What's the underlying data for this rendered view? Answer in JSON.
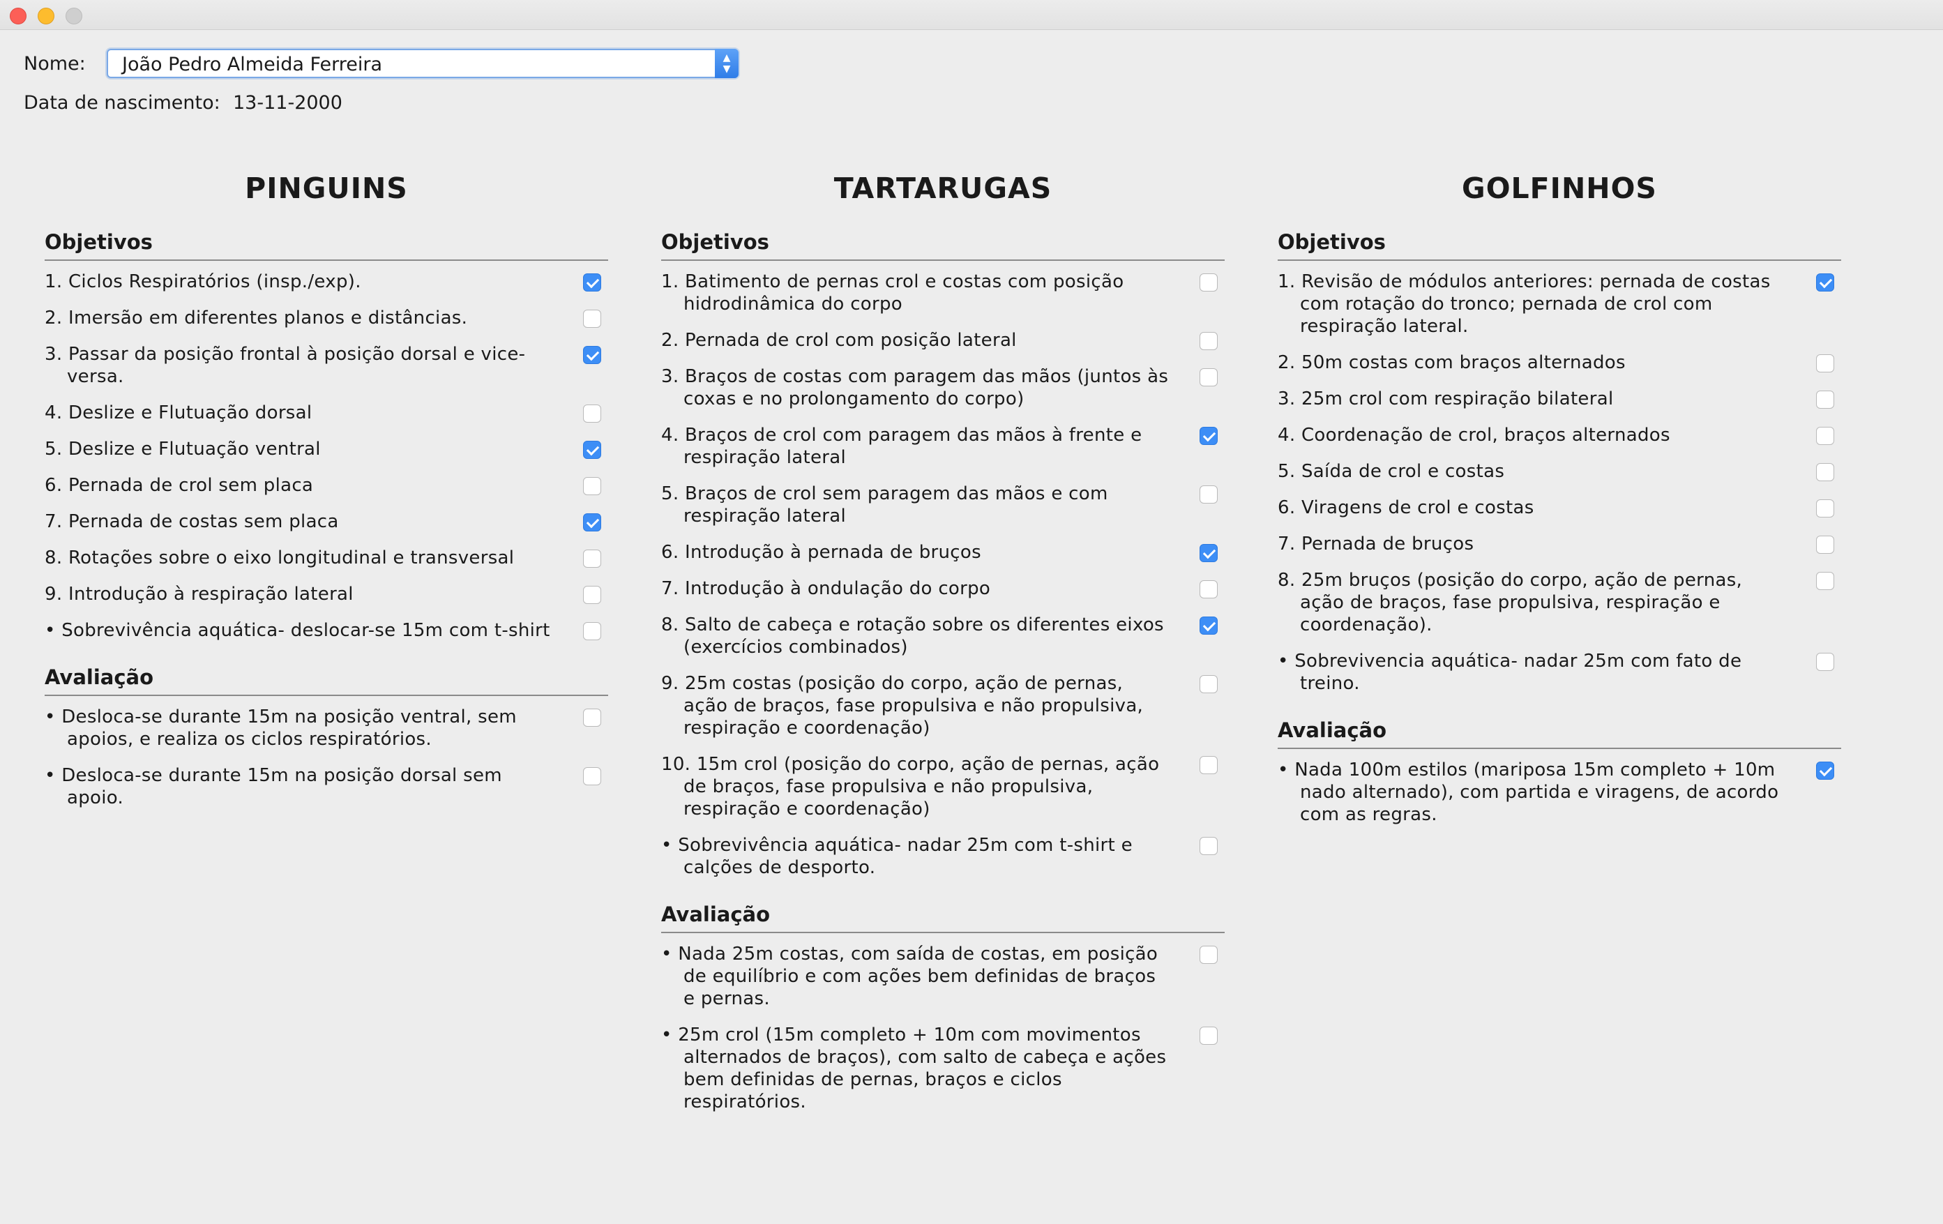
{
  "form": {
    "name_label": "Nome:",
    "name_value": "João Pedro Almeida Ferreira",
    "birth_label": "Data de nascimento:",
    "birth_value": "13-11-2000"
  },
  "columns": [
    {
      "title": "PINGUINS",
      "objectives_title": "Objetivos",
      "objectives": [
        {
          "text": "1. Ciclos Respiratórios (insp./exp).",
          "checked": true
        },
        {
          "text": "2. Imersão em diferentes planos e distâncias.",
          "checked": false
        },
        {
          "text": "3. Passar da posição frontal à posição dorsal e vice-versa.",
          "checked": true
        },
        {
          "text": "4. Deslize e Flutuação dorsal",
          "checked": false
        },
        {
          "text": "5. Deslize e Flutuação ventral",
          "checked": true
        },
        {
          "text": "6. Pernada de crol sem placa",
          "checked": false
        },
        {
          "text": "7. Pernada de costas sem placa",
          "checked": true
        },
        {
          "text": "8. Rotações sobre o eixo longitudinal e transversal",
          "checked": false
        },
        {
          "text": "9. Introdução à respiração lateral",
          "checked": false
        },
        {
          "text": "• Sobrevivência aquática- deslocar-se 15m com t-shirt",
          "checked": false
        }
      ],
      "evaluation_title": "Avaliação",
      "evaluation": [
        {
          "text": "• Desloca-se durante 15m na posição ventral, sem apoios, e realiza os ciclos respiratórios.",
          "checked": false
        },
        {
          "text": "• Desloca-se durante 15m na posição dorsal sem apoio.",
          "checked": false
        }
      ]
    },
    {
      "title": "TARTARUGAS",
      "objectives_title": "Objetivos",
      "objectives": [
        {
          "text": "1. Batimento de pernas crol e costas com posição hidrodinâmica do corpo",
          "checked": false
        },
        {
          "text": "2. Pernada de crol com posição lateral",
          "checked": false
        },
        {
          "text": "3. Braços de costas com paragem das mãos (juntos às coxas e no prolongamento do corpo)",
          "checked": false
        },
        {
          "text": "4. Braços de crol com paragem das mãos à frente e respiração lateral",
          "checked": true
        },
        {
          "text": "5. Braços de crol sem paragem das mãos e com respiração lateral",
          "checked": false
        },
        {
          "text": "6. Introdução à pernada de bruços",
          "checked": true
        },
        {
          "text": "7. Introdução à ondulação do corpo",
          "checked": false
        },
        {
          "text": "8. Salto de cabeça e rotação sobre os diferentes eixos (exercícios combinados)",
          "checked": true
        },
        {
          "text": "9. 25m costas (posição do corpo, ação de pernas, ação de braços, fase propulsiva e não propulsiva, respiração e coordenação)",
          "checked": false
        },
        {
          "text": "10. 15m crol (posição do corpo, ação de pernas, ação de braços, fase propulsiva e não propulsiva, respiração e coordenação)",
          "checked": false
        },
        {
          "text": "• Sobrevivência aquática- nadar 25m com t-shirt e calções de desporto.",
          "checked": false
        }
      ],
      "evaluation_title": "Avaliação",
      "evaluation": [
        {
          "text": "• Nada 25m costas, com saída de costas, em posição de equilíbrio e com ações bem definidas de braços e pernas.",
          "checked": false
        },
        {
          "text": "• 25m crol (15m completo + 10m com movimentos alternados de braços), com salto de cabeça e ações bem definidas de pernas, braços e ciclos respiratórios.",
          "checked": false
        }
      ]
    },
    {
      "title": "GOLFINHOS",
      "objectives_title": "Objetivos",
      "objectives": [
        {
          "text": "1. Revisão de módulos anteriores: pernada de costas com rotação do tronco; pernada de crol com respiração lateral.",
          "checked": true
        },
        {
          "text": "2. 50m costas com braços alternados",
          "checked": false
        },
        {
          "text": "3. 25m crol com respiração bilateral",
          "checked": false
        },
        {
          "text": "4. Coordenação de crol, braços alternados",
          "checked": false
        },
        {
          "text": "5. Saída de crol e costas",
          "checked": false
        },
        {
          "text": "6. Viragens de crol e costas",
          "checked": false
        },
        {
          "text": "7. Pernada de bruços",
          "checked": false
        },
        {
          "text": "8. 25m bruços (posição do corpo, ação de pernas, ação de braços, fase propulsiva, respiração e coordenação).",
          "checked": false
        },
        {
          "text": "• Sobrevivencia aquática- nadar 25m com fato de treino.",
          "checked": false
        }
      ],
      "evaluation_title": "Avaliação",
      "evaluation": [
        {
          "text": "• Nada 100m estilos (mariposa 15m completo + 10m nado alternado), com partida e viragens, de acordo com as regras.",
          "checked": true
        }
      ]
    }
  ]
}
